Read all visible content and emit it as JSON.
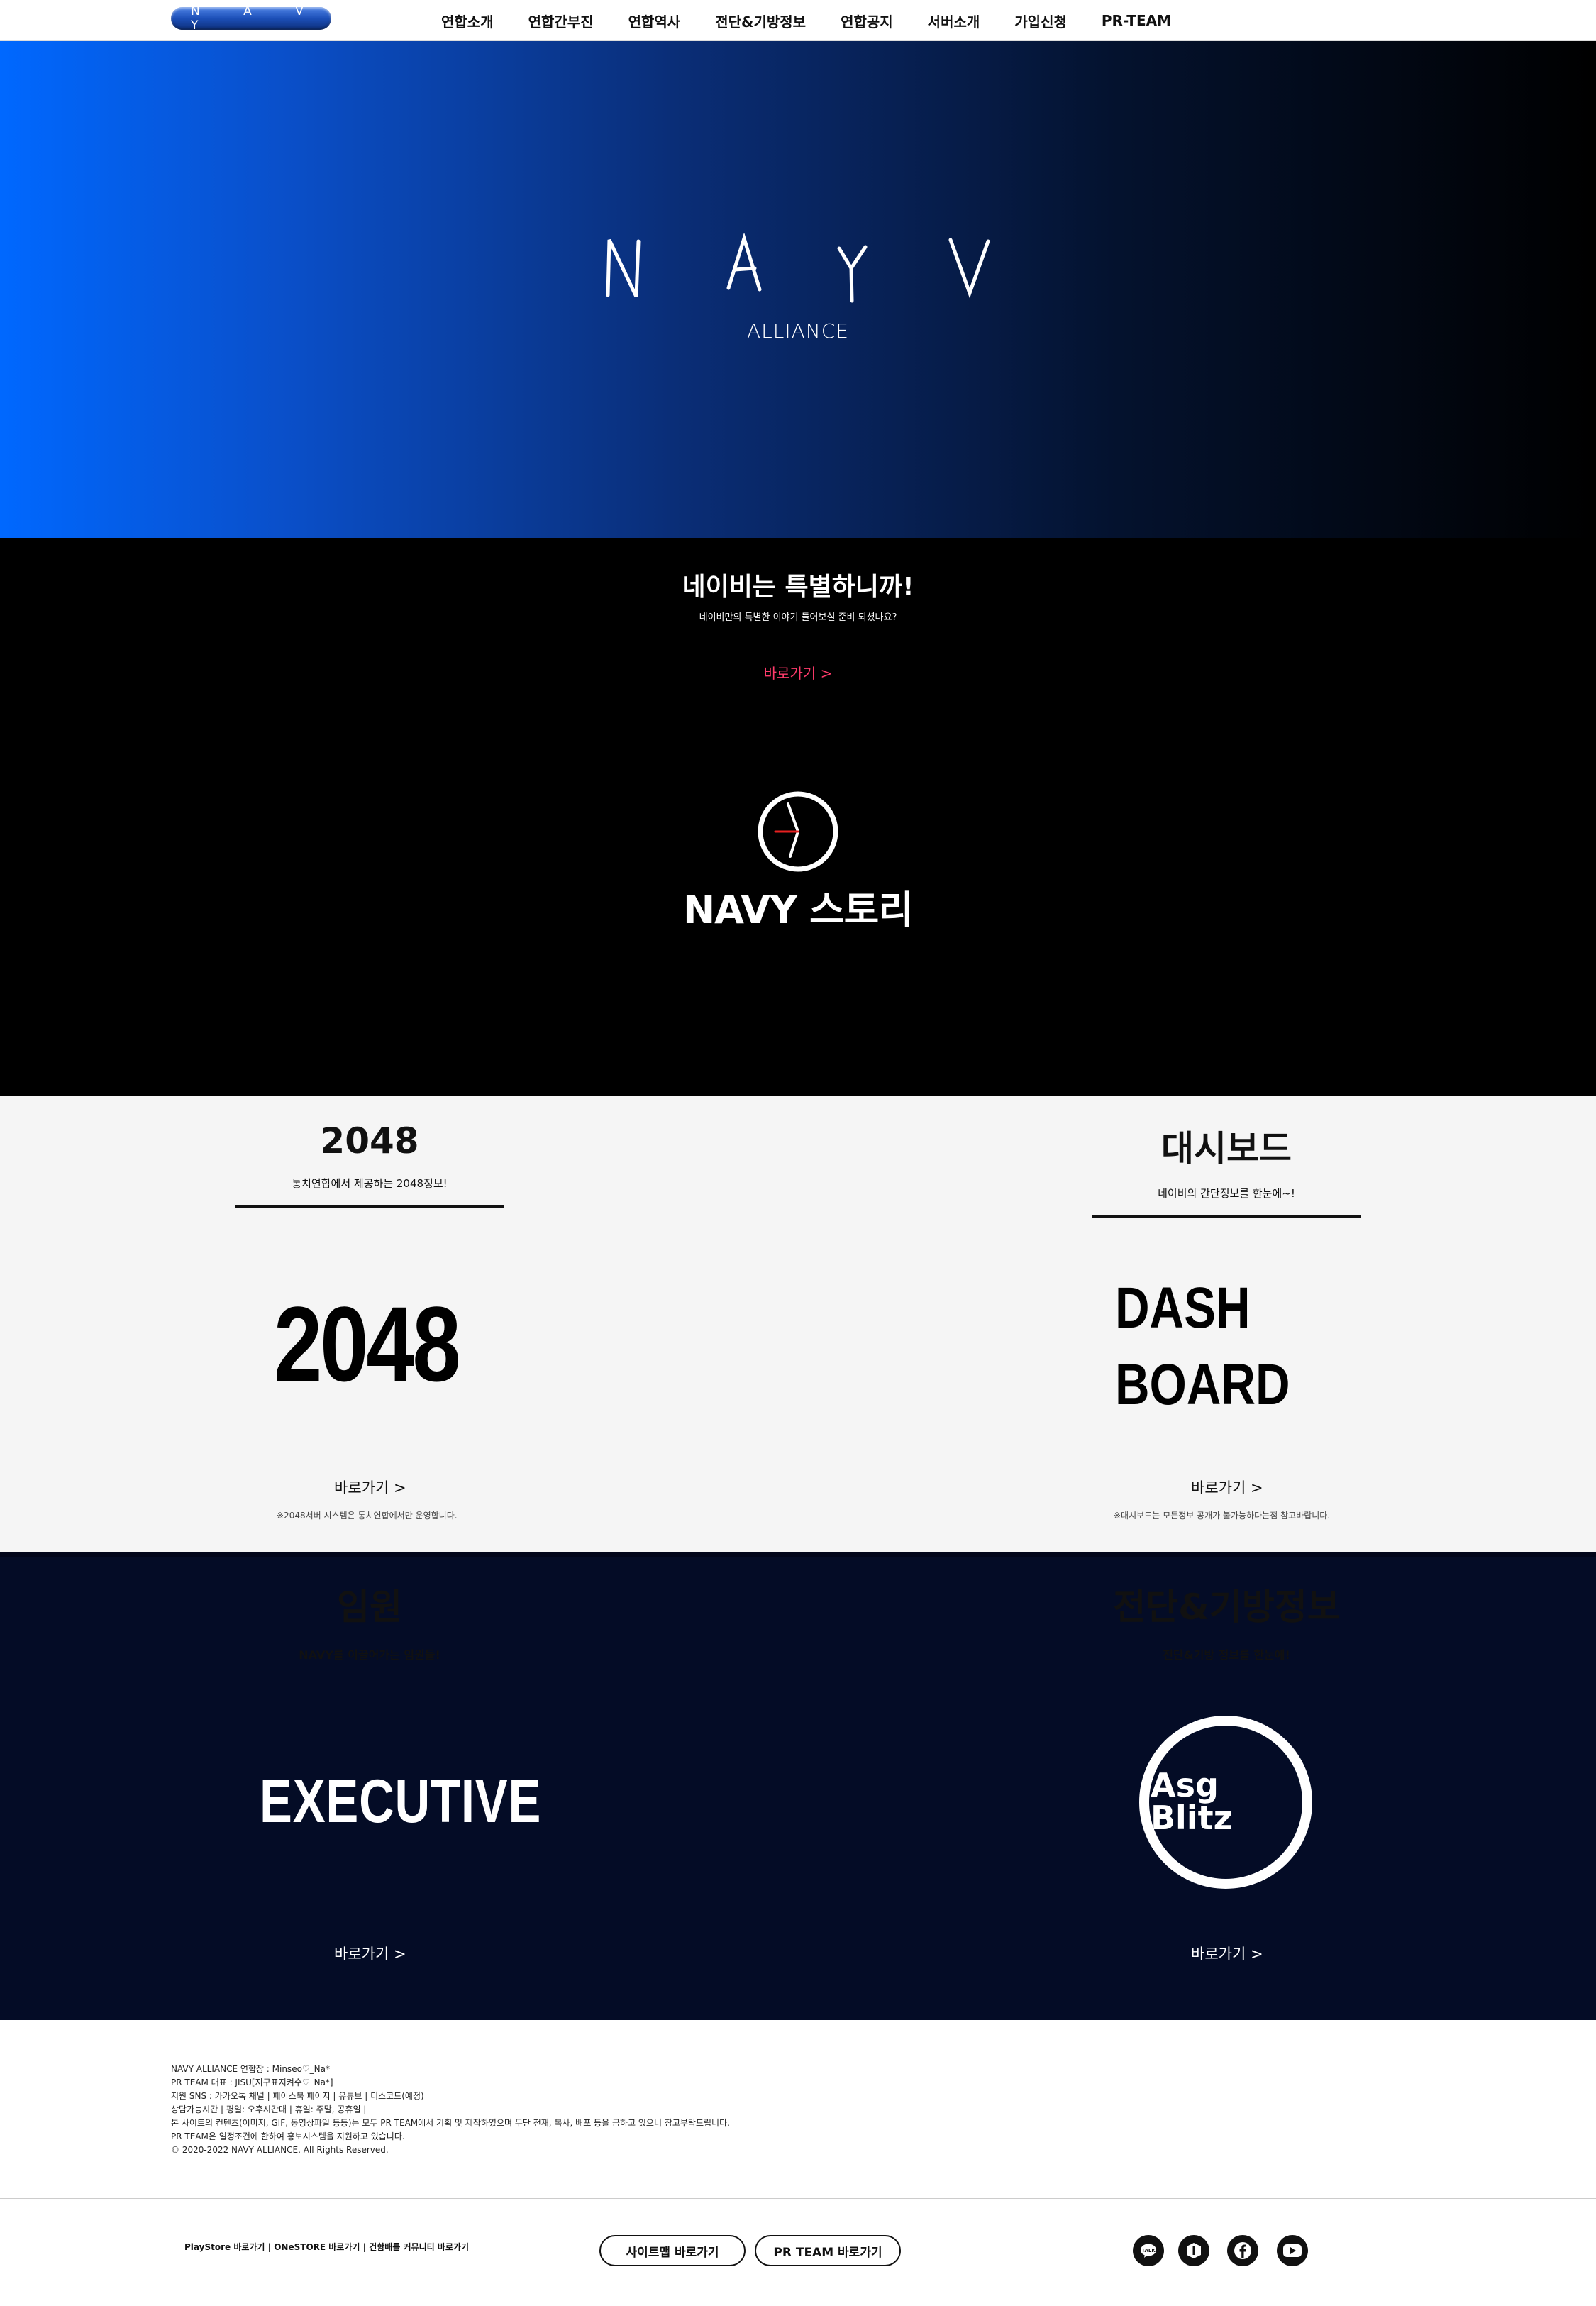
{
  "nav": {
    "logo_text": "N A V Y",
    "items": [
      "연합소개",
      "연합간부진",
      "연합역사",
      "전단&기방정보",
      "연합공지",
      "서버소개",
      "가입신청",
      "PR-TEAM"
    ]
  },
  "hero": {
    "logo_text": "N A Y V",
    "subtitle": "ALLIANCE"
  },
  "story": {
    "title": "네이비는 특별하니까!",
    "subtitle": "네이비만의 특별한 이야기 들어보실 준비 되셨나요?",
    "link": "바로가기 >",
    "brand": "NAVY 스토리",
    "icon": "clock-icon"
  },
  "gray_section": {
    "left": {
      "title": "2048",
      "subtitle": "통치연합에서 제공하는 2048정보!",
      "big_text": "2048",
      "link": "바로가기 >",
      "note": "※2048서버 시스템은 통치연합에서만 운영합니다."
    },
    "right": {
      "title": "대시보드",
      "subtitle": "네이비의 간단정보를 한눈에~!",
      "big_text_line1": "DASH",
      "big_text_line2": "BOARD",
      "link": "바로가기 >",
      "note": "※대시보드는 모든정보 공개가 불가능하다는점 참고바랍니다."
    }
  },
  "navy_section": {
    "left": {
      "title": "임원",
      "subtitle": "NAVY를 이끌어가는 임원들!",
      "big_text": "EXECUTIVE",
      "link": "바로가기 >"
    },
    "right": {
      "title": "전단&기방정보",
      "subtitle": "전단&기방 정보를 한눈에!",
      "logo_line1": "Asg",
      "logo_line2": "Blitz",
      "link": "바로가기 >"
    }
  },
  "footer": {
    "info": [
      "NAVY ALLIANCE 연합장 : Minseo♡_Na*",
      "PR TEAM 대표 : JISU[지구표지켜수♡_Na*]",
      "지원 SNS : 카카오톡 채널  |  페이스북 페이지  |  유튜브  |  디스코드(예정)",
      "상담가능시간  |  평일: 오후시간대  |  휴일: 주말, 공휴일  |",
      "본 사이트의 컨텐츠(이미지, GIF, 동영상파일 등등)는 모두 PR TEAM에서 기획 및 제작하였으며 무단 전재, 복사, 배포 등을 금하고 있으니 참고부탁드립니다.",
      "PR TEAM은 일정조건에 한하여 홍보시스템을 지원하고 있습니다.",
      "© 2020-2022 NAVY ALLIANCE. All Rights Reserved."
    ],
    "links": [
      "PlayStore 바로가기",
      "ONeSTORE 바로가기",
      "건함배틀 커뮤니티 바로가기"
    ],
    "pill_buttons": [
      "사이트맵 바로가기",
      "PR TEAM 바로가기"
    ],
    "social_icons": [
      "talk-icon",
      "channel-icon",
      "facebook-icon",
      "youtube-icon"
    ]
  }
}
